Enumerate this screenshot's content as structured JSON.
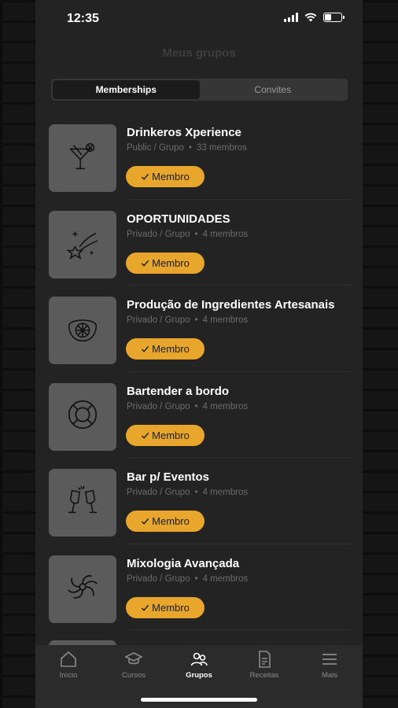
{
  "status_bar": {
    "time": "12:35"
  },
  "header": {
    "title": "Meus grupos"
  },
  "tabs": [
    {
      "label": "Memberships",
      "active": true
    },
    {
      "label": "Convites",
      "active": false
    }
  ],
  "groups": [
    {
      "name": "Drinkeros Xperience",
      "visibility": "Public / Grupo",
      "members": "33 membros",
      "badge": "Membro",
      "icon": "cocktail-icon"
    },
    {
      "name": "OPORTUNIDADES",
      "visibility": "Privado / Grupo",
      "members": "4 membros",
      "badge": "Membro",
      "icon": "shooting-star-icon"
    },
    {
      "name": "Produção de Ingredientes Artesanais",
      "visibility": "Privado / Grupo",
      "members": "4 membros",
      "badge": "Membro",
      "icon": "citrus-icon"
    },
    {
      "name": "Bartender a bordo",
      "visibility": "Privado / Grupo",
      "members": "4 membros",
      "badge": "Membro",
      "icon": "lifebuoy-icon"
    },
    {
      "name": "Bar p/ Eventos",
      "visibility": "Privado / Grupo",
      "members": "4 membros",
      "badge": "Membro",
      "icon": "champagne-toast-icon"
    },
    {
      "name": "Mixologia Avançada",
      "visibility": "Privado / Grupo",
      "members": "4 membros",
      "badge": "Membro",
      "icon": "swirl-icon"
    }
  ],
  "nav": [
    {
      "label": "Início",
      "icon": "home-icon",
      "active": false
    },
    {
      "label": "Cursos",
      "icon": "graduation-cap-icon",
      "active": false
    },
    {
      "label": "Grupos",
      "icon": "users-icon",
      "active": true
    },
    {
      "label": "Receitas",
      "icon": "recipe-icon",
      "active": false
    },
    {
      "label": "Mais",
      "icon": "menu-icon",
      "active": false
    }
  ],
  "colors": {
    "accent": "#e9a62c",
    "background": "#232323",
    "thumbnail": "#5b5b5b"
  }
}
